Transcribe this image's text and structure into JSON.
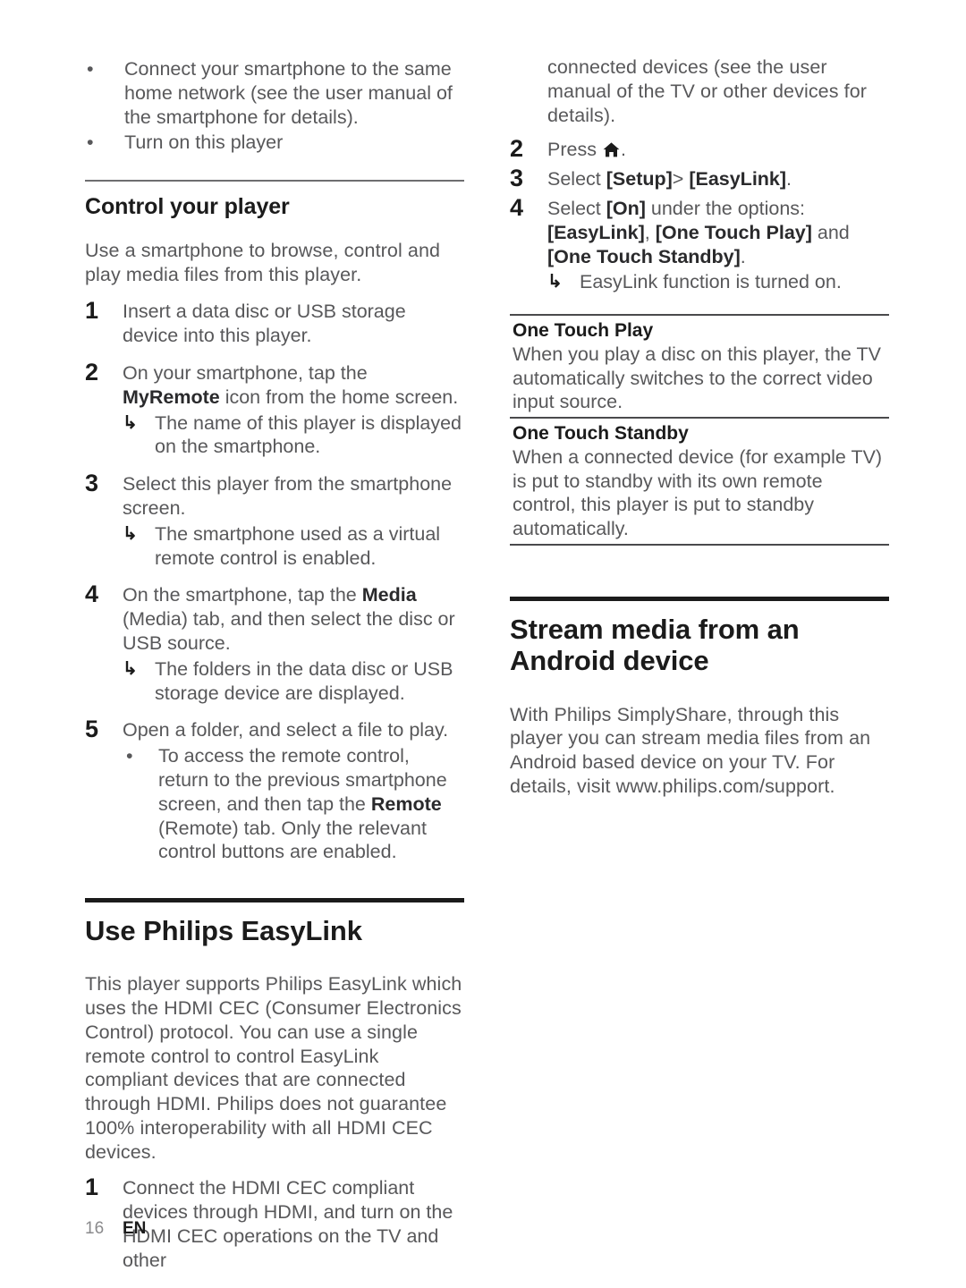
{
  "document": {
    "footer": {
      "page_number": "16",
      "language": "EN"
    }
  },
  "left_column": {
    "intro_bullets": [
      {
        "marker": "•",
        "text": "Connect your smartphone to the same home network (see the user manual of the smartphone for details)."
      },
      {
        "marker": "•",
        "text": "Turn on this player"
      }
    ],
    "sub_heading": "Control your player",
    "intro_paragraph": "Use a smartphone to browse, control and play media files from this player.",
    "steps": [
      {
        "number": "1",
        "text": "Insert a data disc or USB storage device into this player."
      },
      {
        "number": "2",
        "text_pre": "On your smartphone, tap the ",
        "bold": "MyRemote",
        "text_post": " icon from the home screen.",
        "result": {
          "marker": "↳",
          "text": "The name of this player is displayed on the smartphone."
        }
      },
      {
        "number": "3",
        "text": "Select this player from the smartphone screen.",
        "result": {
          "marker": "↳",
          "text": "The smartphone used as a virtual remote control is enabled."
        }
      },
      {
        "number": "4",
        "text_pre": "On the smartphone, tap the ",
        "bold": "Media",
        "text_post": " (Media) tab, and then select the disc or USB source.",
        "result": {
          "marker": "↳",
          "text": "The folders in the data disc or USB storage device are displayed."
        }
      },
      {
        "number": "5",
        "text": "Open a folder, and select a file to play.",
        "bullet": {
          "marker": "•",
          "text_pre": "To access the remote control, return to the previous smartphone screen, and then tap the ",
          "bold": "Remote",
          "text_post": " (Remote) tab. Only the relevant control buttons are enabled."
        }
      }
    ],
    "easylink": {
      "heading": "Use Philips EasyLink",
      "paragraph": "This player supports Philips EasyLink which uses the HDMI CEC (Consumer Electronics Control) protocol. You can use a single remote control to control EasyLink compliant devices that are connected through HDMI. Philips does not guarantee 100% interoperability with all HDMI CEC devices.",
      "step1": {
        "number": "1",
        "text": "Connect the HDMI CEC compliant devices through HDMI, and turn on the HDMI CEC operations on the TV and other"
      }
    }
  },
  "right_column": {
    "continued_text": "connected devices (see the user manual of the TV or other devices for details).",
    "steps": [
      {
        "number": "2",
        "text_pre": "Press ",
        "icon": "home-icon",
        "text_post": "."
      },
      {
        "number": "3",
        "text_pre": "Select ",
        "bold1": "[Setup]",
        "text_mid": "> ",
        "bold2": "[EasyLink]",
        "text_post": "."
      },
      {
        "number": "4",
        "text_pre": "Select ",
        "bold1": "[On]",
        "text_mid": " under the options: ",
        "bold2": "[EasyLink]",
        "text_mid2": ", ",
        "bold3": "[One Touch Play]",
        "text_mid3": " and ",
        "bold4": "[One Touch Standby]",
        "text_post": ".",
        "result": {
          "marker": "↳",
          "text": "EasyLink function is turned on."
        }
      }
    ],
    "notes": [
      {
        "title": "One Touch Play",
        "text": "When you play a disc on this player, the TV automatically switches to the correct video input source."
      },
      {
        "title": "One Touch Standby",
        "text": "When a connected device (for example TV) is put to standby with its own remote control, this player is put to standby automatically."
      }
    ],
    "stream": {
      "heading_line1": "Stream media from an",
      "heading_line2": "Android device",
      "paragraph": "With Philips SimplyShare, through this player you can stream media files from an Android based device on your TV. For details, visit www.philips.com/support."
    }
  }
}
